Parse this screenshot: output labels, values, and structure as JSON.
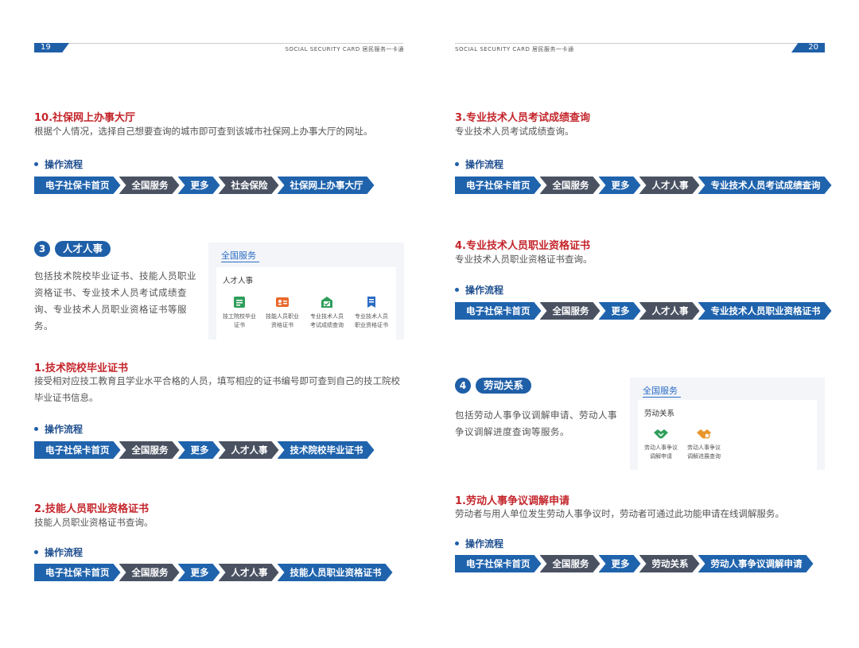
{
  "left_page": {
    "page_number": "19",
    "header": "SOCIAL SECURITY CARD  居民服务一卡通",
    "item10": {
      "title": "10.社保网上办事大厅",
      "desc": "根据个人情况，选择自己想要查询的城市即可查到该城市社保网上办事大厅的网址。",
      "flow_label": "操作流程",
      "steps": [
        "电子社保卡首页",
        "全国服务",
        "更多",
        "社会保险",
        "社保网上办事大厅"
      ]
    },
    "section3": {
      "number": "3",
      "name": "人才人事",
      "desc": "包括技术院校毕业证书、技能人员职业资格证书、专业技术人员考试成绩查询、专业技术人员职业资格证书等服务。",
      "card": {
        "tab": "全国服务",
        "inner_title": "人才人事",
        "services": [
          {
            "line1": "技工院校毕业",
            "line2": "证书",
            "icon": "certificate-icon",
            "color": "#2e9e5b"
          },
          {
            "line1": "技能人员职业",
            "line2": "资格证书",
            "icon": "id-card-icon",
            "color": "#e8692c"
          },
          {
            "line1": "专业技术人员",
            "line2": "考试成绩查询",
            "icon": "exam-result-icon",
            "color": "#2e9e5b"
          },
          {
            "line1": "专业技术人员",
            "line2": "职业资格证书",
            "icon": "qualification-icon",
            "color": "#2b6cc4"
          }
        ]
      }
    },
    "item1": {
      "title": "1.技术院校毕业证书",
      "desc": "接受相对应技工教育且学业水平合格的人员，填写相应的证书编号即可查到自己的技工院校毕业证书信息。",
      "flow_label": "操作流程",
      "steps": [
        "电子社保卡首页",
        "全国服务",
        "更多",
        "人才人事",
        "技术院校毕业证书"
      ]
    },
    "item2": {
      "title": "2.技能人员职业资格证书",
      "desc": "技能人员职业资格证书查询。",
      "flow_label": "操作流程",
      "steps": [
        "电子社保卡首页",
        "全国服务",
        "更多",
        "人才人事",
        "技能人员职业资格证书"
      ]
    }
  },
  "right_page": {
    "page_number": "20",
    "header": "SOCIAL SECURITY CARD  居民服务一卡通",
    "item3": {
      "title": "3.专业技术人员考试成绩查询",
      "desc": "专业技术人员考试成绩查询。",
      "flow_label": "操作流程",
      "steps": [
        "电子社保卡首页",
        "全国服务",
        "更多",
        "人才人事",
        "专业技术人员考试成绩查询"
      ]
    },
    "item4": {
      "title": "4.专业技术人员职业资格证书",
      "desc": "专业技术人员职业资格证书查询。",
      "flow_label": "操作流程",
      "steps": [
        "电子社保卡首页",
        "全国服务",
        "更多",
        "人才人事",
        "专业技术人员职业资格证书"
      ]
    },
    "section4": {
      "number": "4",
      "name": "劳动关系",
      "desc": "包括劳动人事争议调解申请、劳动人事争议调解进度查询等服务。",
      "card": {
        "tab": "全国服务",
        "inner_title": "劳动关系",
        "services": [
          {
            "line1": "劳动人事争议",
            "line2": "调解申请",
            "icon": "handshake-icon",
            "color": "#2e9e5b"
          },
          {
            "line1": "劳动人事争议",
            "line2": "调解进展查询",
            "icon": "handshake-search-icon",
            "color": "#e8962c"
          }
        ]
      }
    },
    "item1b": {
      "title": "1.劳动人事争议调解申请",
      "desc": "劳动者与用人单位发生劳动人事争议时，劳动者可通过此功能申请在线调解服务。",
      "flow_label": "操作流程",
      "steps": [
        "电子社保卡首页",
        "全国服务",
        "更多",
        "劳动关系",
        "劳动人事争议调解申请"
      ]
    }
  }
}
